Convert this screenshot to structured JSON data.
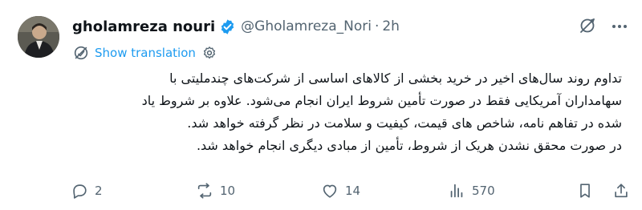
{
  "tweet": {
    "author": {
      "name": "gholamreza nouri",
      "handle": "@Gholamreza_Nori",
      "separator": "·",
      "time": "2h"
    },
    "translate_label": "Show translation",
    "body_lines": [
      "تداوم روند سال‌های اخیر در خرید بخشی از کالاهای اساسی از شرکت‌های چندملیتی با",
      "سهامداران آمریکایی فقط در صورت تأمین شروط ایران انجام می‌شود. علاوه بر شروط یاد",
      "شده در تفاهم نامه، شاخص های قیمت، کیفیت و سلامت در نظر گرفته خواهد شد.",
      "در صورت محقق نشدن هریک از شروط، تأمین از مبادی دیگری انجام خواهد شد."
    ],
    "stats": {
      "replies": "2",
      "reposts": "10",
      "likes": "14",
      "views": "570"
    },
    "colors": {
      "accent": "#1d9bf0",
      "muted": "#536471",
      "text": "#0f1419"
    }
  }
}
